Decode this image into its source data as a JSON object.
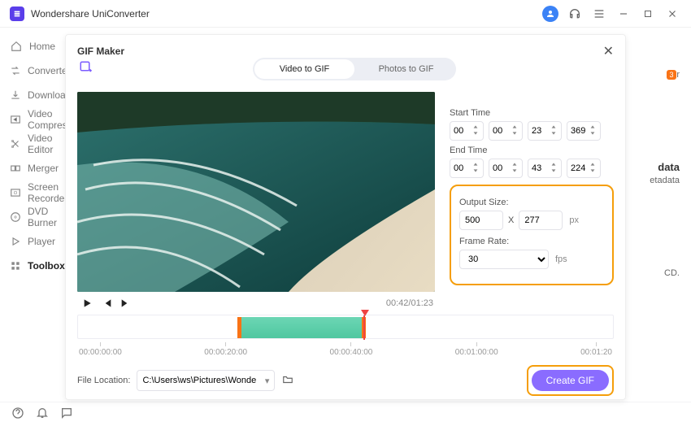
{
  "app": {
    "title": "Wondershare UniConverter"
  },
  "sidebar": {
    "items": [
      {
        "label": "Home"
      },
      {
        "label": "Converter"
      },
      {
        "label": "Downloader"
      },
      {
        "label": "Video Compressor"
      },
      {
        "label": "Video Editor"
      },
      {
        "label": "Merger"
      },
      {
        "label": "Screen Recorder"
      },
      {
        "label": "DVD Burner"
      },
      {
        "label": "Player"
      },
      {
        "label": "Toolbox"
      }
    ]
  },
  "background": {
    "right_top": "tor",
    "badge": "3",
    "data_label": "data",
    "metadata": "etadata",
    "cd": "CD."
  },
  "modal": {
    "title": "GIF Maker",
    "tabs": {
      "video": "Video to GIF",
      "photos": "Photos to GIF"
    },
    "time_display": "00:42/01:23",
    "start_label": "Start Time",
    "end_label": "End Time",
    "start": {
      "hh": "00",
      "mm": "00",
      "ss": "23",
      "ms": "369"
    },
    "end": {
      "hh": "00",
      "mm": "00",
      "ss": "43",
      "ms": "224"
    },
    "output_size_label": "Output Size:",
    "output_w": "500",
    "output_h": "277",
    "x": "X",
    "px": "px",
    "frame_rate_label": "Frame Rate:",
    "frame_rate": "30",
    "fps": "fps",
    "ruler": [
      "00:00:00:00",
      "00:00:20:00",
      "00:00:40:00",
      "00:01:00:00",
      "00:01:20"
    ],
    "file_location_label": "File Location:",
    "file_location": "C:\\Users\\ws\\Pictures\\Wonders",
    "create": "Create GIF"
  }
}
